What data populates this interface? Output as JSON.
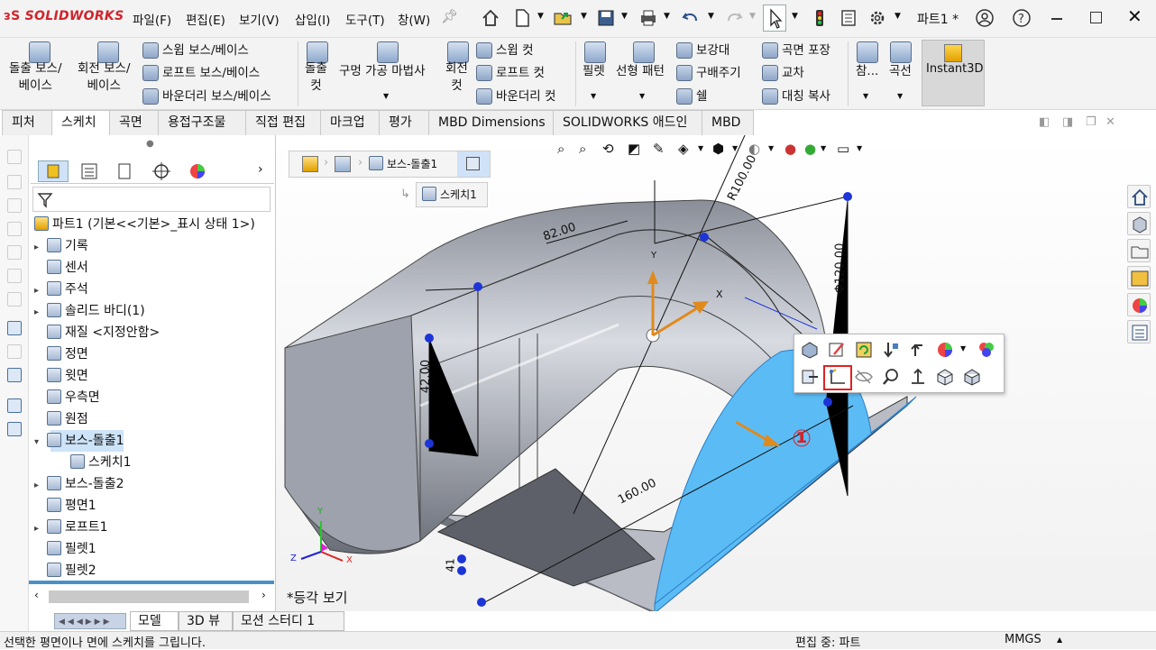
{
  "app": {
    "logo": "SOLIDWORKS",
    "doc_title": "파트1 *"
  },
  "menu": [
    "파일(F)",
    "편집(E)",
    "보기(V)",
    "삽입(I)",
    "도구(T)",
    "창(W)"
  ],
  "ribbon": {
    "extrude_boss": "돌출 보스/\n베이스",
    "revolve_boss": "회전 보스/\n베이스",
    "sweep_boss": "스윕 보스/베이스",
    "loft_boss": "로프트 보스/베이스",
    "boundary_boss": "바운더리 보스/베이스",
    "extrude_cut": "돌출\n컷",
    "hole_wizard": "구멍 가공 마법사",
    "revolve_cut": "회전\n컷",
    "sweep_cut": "스윕 컷",
    "loft_cut": "로프트 컷",
    "boundary_cut": "바운더리 컷",
    "fillet": "필렛",
    "linear_pattern": "선형 패턴",
    "rib": "보강대",
    "draft": "구배주기",
    "shell": "쉘",
    "wrap": "곡면 포장",
    "intersect": "교차",
    "mirror": "대칭 복사",
    "reference": "참...",
    "curves": "곡선",
    "instant3d": "Instant3D"
  },
  "tabs": [
    "피처",
    "스케치",
    "곡면",
    "용접구조물",
    "직접 편집",
    "마크업",
    "평가",
    "MBD Dimensions",
    "SOLIDWORKS 애드인",
    "MBD"
  ],
  "breadcrumb": {
    "item1": "보스-돌출1",
    "item2": "스케치1"
  },
  "tree": {
    "root": "파트1  (기본<<기본>_표시 상태 1>)",
    "items": [
      {
        "label": "기록",
        "expand": true
      },
      {
        "label": "센서",
        "expand": false
      },
      {
        "label": "주석",
        "expand": true
      },
      {
        "label": "솔리드 바디(1)",
        "expand": true
      },
      {
        "label": "재질 <지정안함>",
        "expand": false
      },
      {
        "label": "정면",
        "expand": false
      },
      {
        "label": "윗면",
        "expand": false
      },
      {
        "label": "우측면",
        "expand": false
      },
      {
        "label": "원점",
        "expand": false
      },
      {
        "label": "보스-돌출1",
        "expand": true,
        "selected": true
      },
      {
        "label": "스케치1",
        "expand": false,
        "child": true
      },
      {
        "label": "보스-돌출2",
        "expand": true
      },
      {
        "label": "평면1",
        "expand": false
      },
      {
        "label": "로프트1",
        "expand": true
      },
      {
        "label": "필렛1",
        "expand": false
      },
      {
        "label": "필렛2",
        "expand": false
      }
    ]
  },
  "viewport": {
    "view_label": "*등각 보기",
    "dims": {
      "r100": "R100.00",
      "d82": "82.00",
      "d42": "42.00",
      "dia120": "Φ120.00",
      "d160": "160.00",
      "d41": "41"
    },
    "marker": "①",
    "axis": {
      "x": "X",
      "y": "Y"
    },
    "triad": {
      "x": "X",
      "y": "Y",
      "z": "Z"
    }
  },
  "bottom_tabs": [
    "모델",
    "3D 뷰",
    "모션 스터디 1"
  ],
  "status": {
    "hint": "선택한 평면이나 면에 스케치를 그립니다.",
    "mode": "편집 중: 파트",
    "units": "MMGS"
  },
  "colors": {
    "accent": "#d2232a",
    "face": "#5bbcf5",
    "selected": "#cde3f7"
  }
}
